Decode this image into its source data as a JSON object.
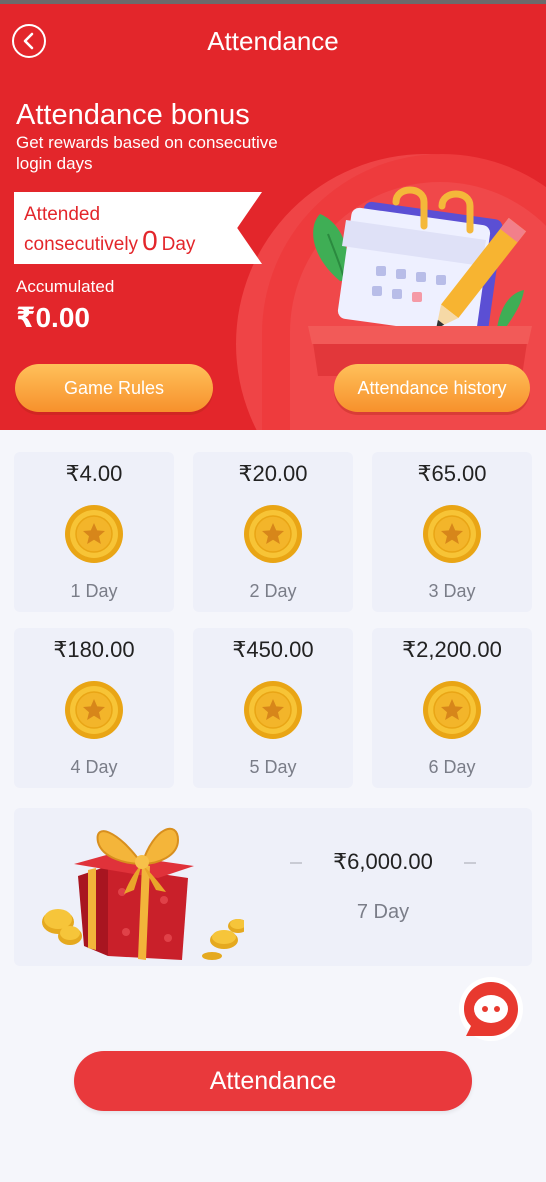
{
  "header": {
    "title": "Attendance",
    "bonus_title": "Attendance bonus",
    "bonus_subtitle": "Get rewards based on consecutive login days",
    "streak": {
      "prefix_line1": "Attended",
      "prefix_line2": "consecutively",
      "count": "0",
      "suffix": "Day"
    },
    "accumulated_label": "Accumulated",
    "accumulated_value": "₹0.00",
    "game_rules_label": "Game Rules",
    "history_label": "Attendance history"
  },
  "rewards": [
    {
      "amount": "₹4.00",
      "day": "1 Day"
    },
    {
      "amount": "₹20.00",
      "day": "2 Day"
    },
    {
      "amount": "₹65.00",
      "day": "3 Day"
    },
    {
      "amount": "₹180.00",
      "day": "4 Day"
    },
    {
      "amount": "₹450.00",
      "day": "5 Day"
    },
    {
      "amount": "₹2,200.00",
      "day": "6 Day"
    }
  ],
  "final_reward": {
    "amount": "₹6,000.00",
    "day": "7 Day"
  },
  "attend_button_label": "Attendance",
  "colors": {
    "brand_red": "#e3262b",
    "button_orange_top": "#ffc15a",
    "button_orange_bottom": "#f7912c",
    "card_bg": "#eef0f9"
  },
  "icons": [
    "back-icon",
    "coin-star-icon",
    "gift-box-icon",
    "calendar-pencil-illustration",
    "chat-support-icon"
  ]
}
